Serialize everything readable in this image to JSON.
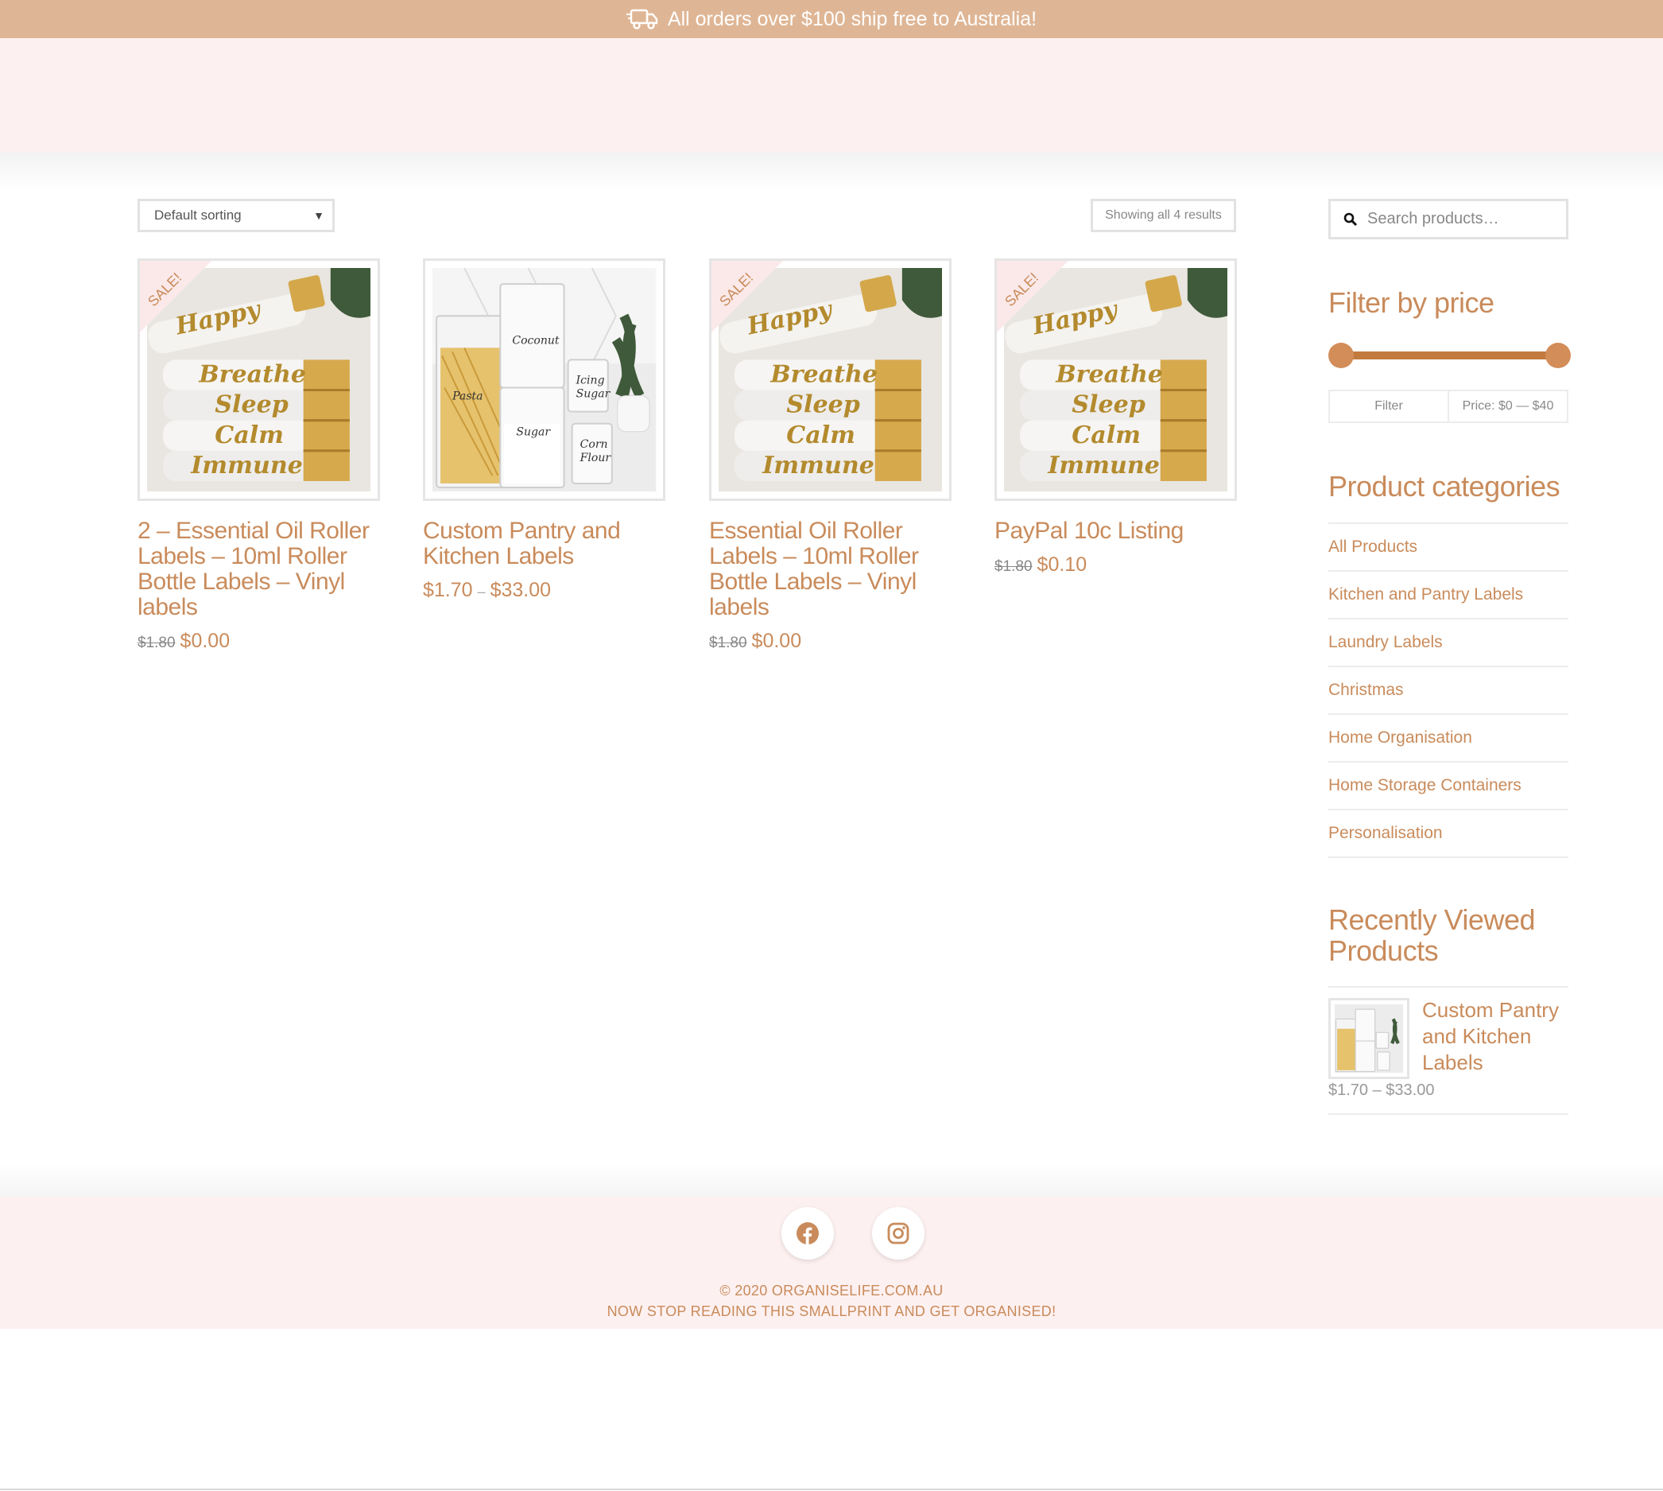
{
  "topbar": {
    "message": "All orders over $100 ship free to Australia!",
    "icon": "delivery-truck-icon"
  },
  "toolbar": {
    "sort_label": "Default sorting",
    "result_count": "Showing all 4 results"
  },
  "products": [
    {
      "sale_badge": "SALE!",
      "title": "2 – Essential Oil Roller Labels – 10ml Roller Bottle Labels – Vinyl labels",
      "old_price": "$1.80",
      "price": "$0.00"
    },
    {
      "title": "Custom Pantry and Kitchen Labels",
      "price_min": "$1.70",
      "price_sep": "–",
      "price_max": "$33.00"
    },
    {
      "sale_badge": "SALE!",
      "title": "Essential Oil Roller Labels – 10ml Roller Bottle Labels – Vinyl labels",
      "old_price": "$1.80",
      "price": "$0.00"
    },
    {
      "sale_badge": "SALE!",
      "title": "PayPal 10c Listing",
      "old_price": "$1.80",
      "price": "$0.10"
    }
  ],
  "sidebar": {
    "search_placeholder": "Search products…",
    "filter_title": "Filter by price",
    "filter_button": "Filter",
    "price_label": "Price: $0 — $40",
    "categories_title": "Product categories",
    "categories": [
      "All Products",
      "Kitchen and Pantry Labels",
      "Laundry Labels",
      "Christmas",
      "Home Organisation",
      "Home Storage Containers",
      "Personalisation"
    ],
    "recent_title": "Recently Viewed Products",
    "recent_item": {
      "title": "Custom Pantry and Kitchen Labels",
      "price": "$1.70 – $33.00"
    }
  },
  "footer": {
    "copyright": "© 2020 ORGANISELIFE.COM.AU",
    "tagline": "NOW STOP READING THIS SMALLPRINT AND GET ORGANISED!",
    "social": [
      "facebook-icon",
      "instagram-icon"
    ]
  },
  "colors": {
    "accent": "#c98b5b",
    "topbar": "#dfb695",
    "header": "#fdf0f0",
    "slider": "#c27a3e"
  }
}
